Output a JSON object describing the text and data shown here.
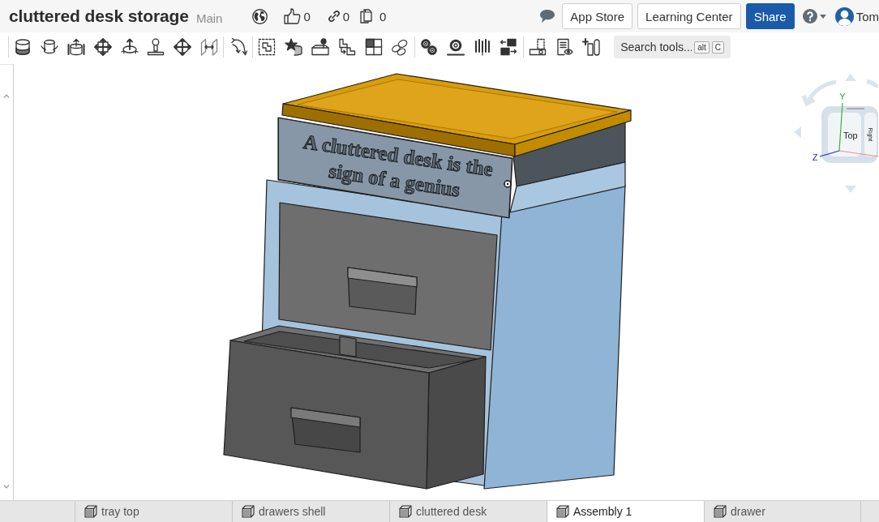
{
  "document": {
    "title": "cluttered desk storage",
    "branch": "Main",
    "likes": "0",
    "links": "0",
    "copies": "0"
  },
  "header_buttons": [
    {
      "label": "App Store",
      "kind": "outline"
    },
    {
      "label": "Learning Center",
      "kind": "outline"
    },
    {
      "label": "Share",
      "kind": "primary"
    }
  ],
  "user": {
    "name": "Tom"
  },
  "tool_search": {
    "placeholder": "Search tools...",
    "shortcut_keys": [
      "alt",
      "C"
    ]
  },
  "viewport": {
    "engraved_text": [
      "A cluttered desk is the",
      "sign of a genius"
    ],
    "view_cube": {
      "top_face": "Top",
      "right_face": "Right",
      "y_axis": "Y",
      "z_axis": "Z"
    }
  },
  "tabs": [
    {
      "label": "tray top",
      "selected": false
    },
    {
      "label": "drawers shell",
      "selected": false
    },
    {
      "label": "cluttered desk",
      "selected": false
    },
    {
      "label": "Assembly 1",
      "selected": true
    },
    {
      "label": "drawer",
      "selected": false
    }
  ]
}
